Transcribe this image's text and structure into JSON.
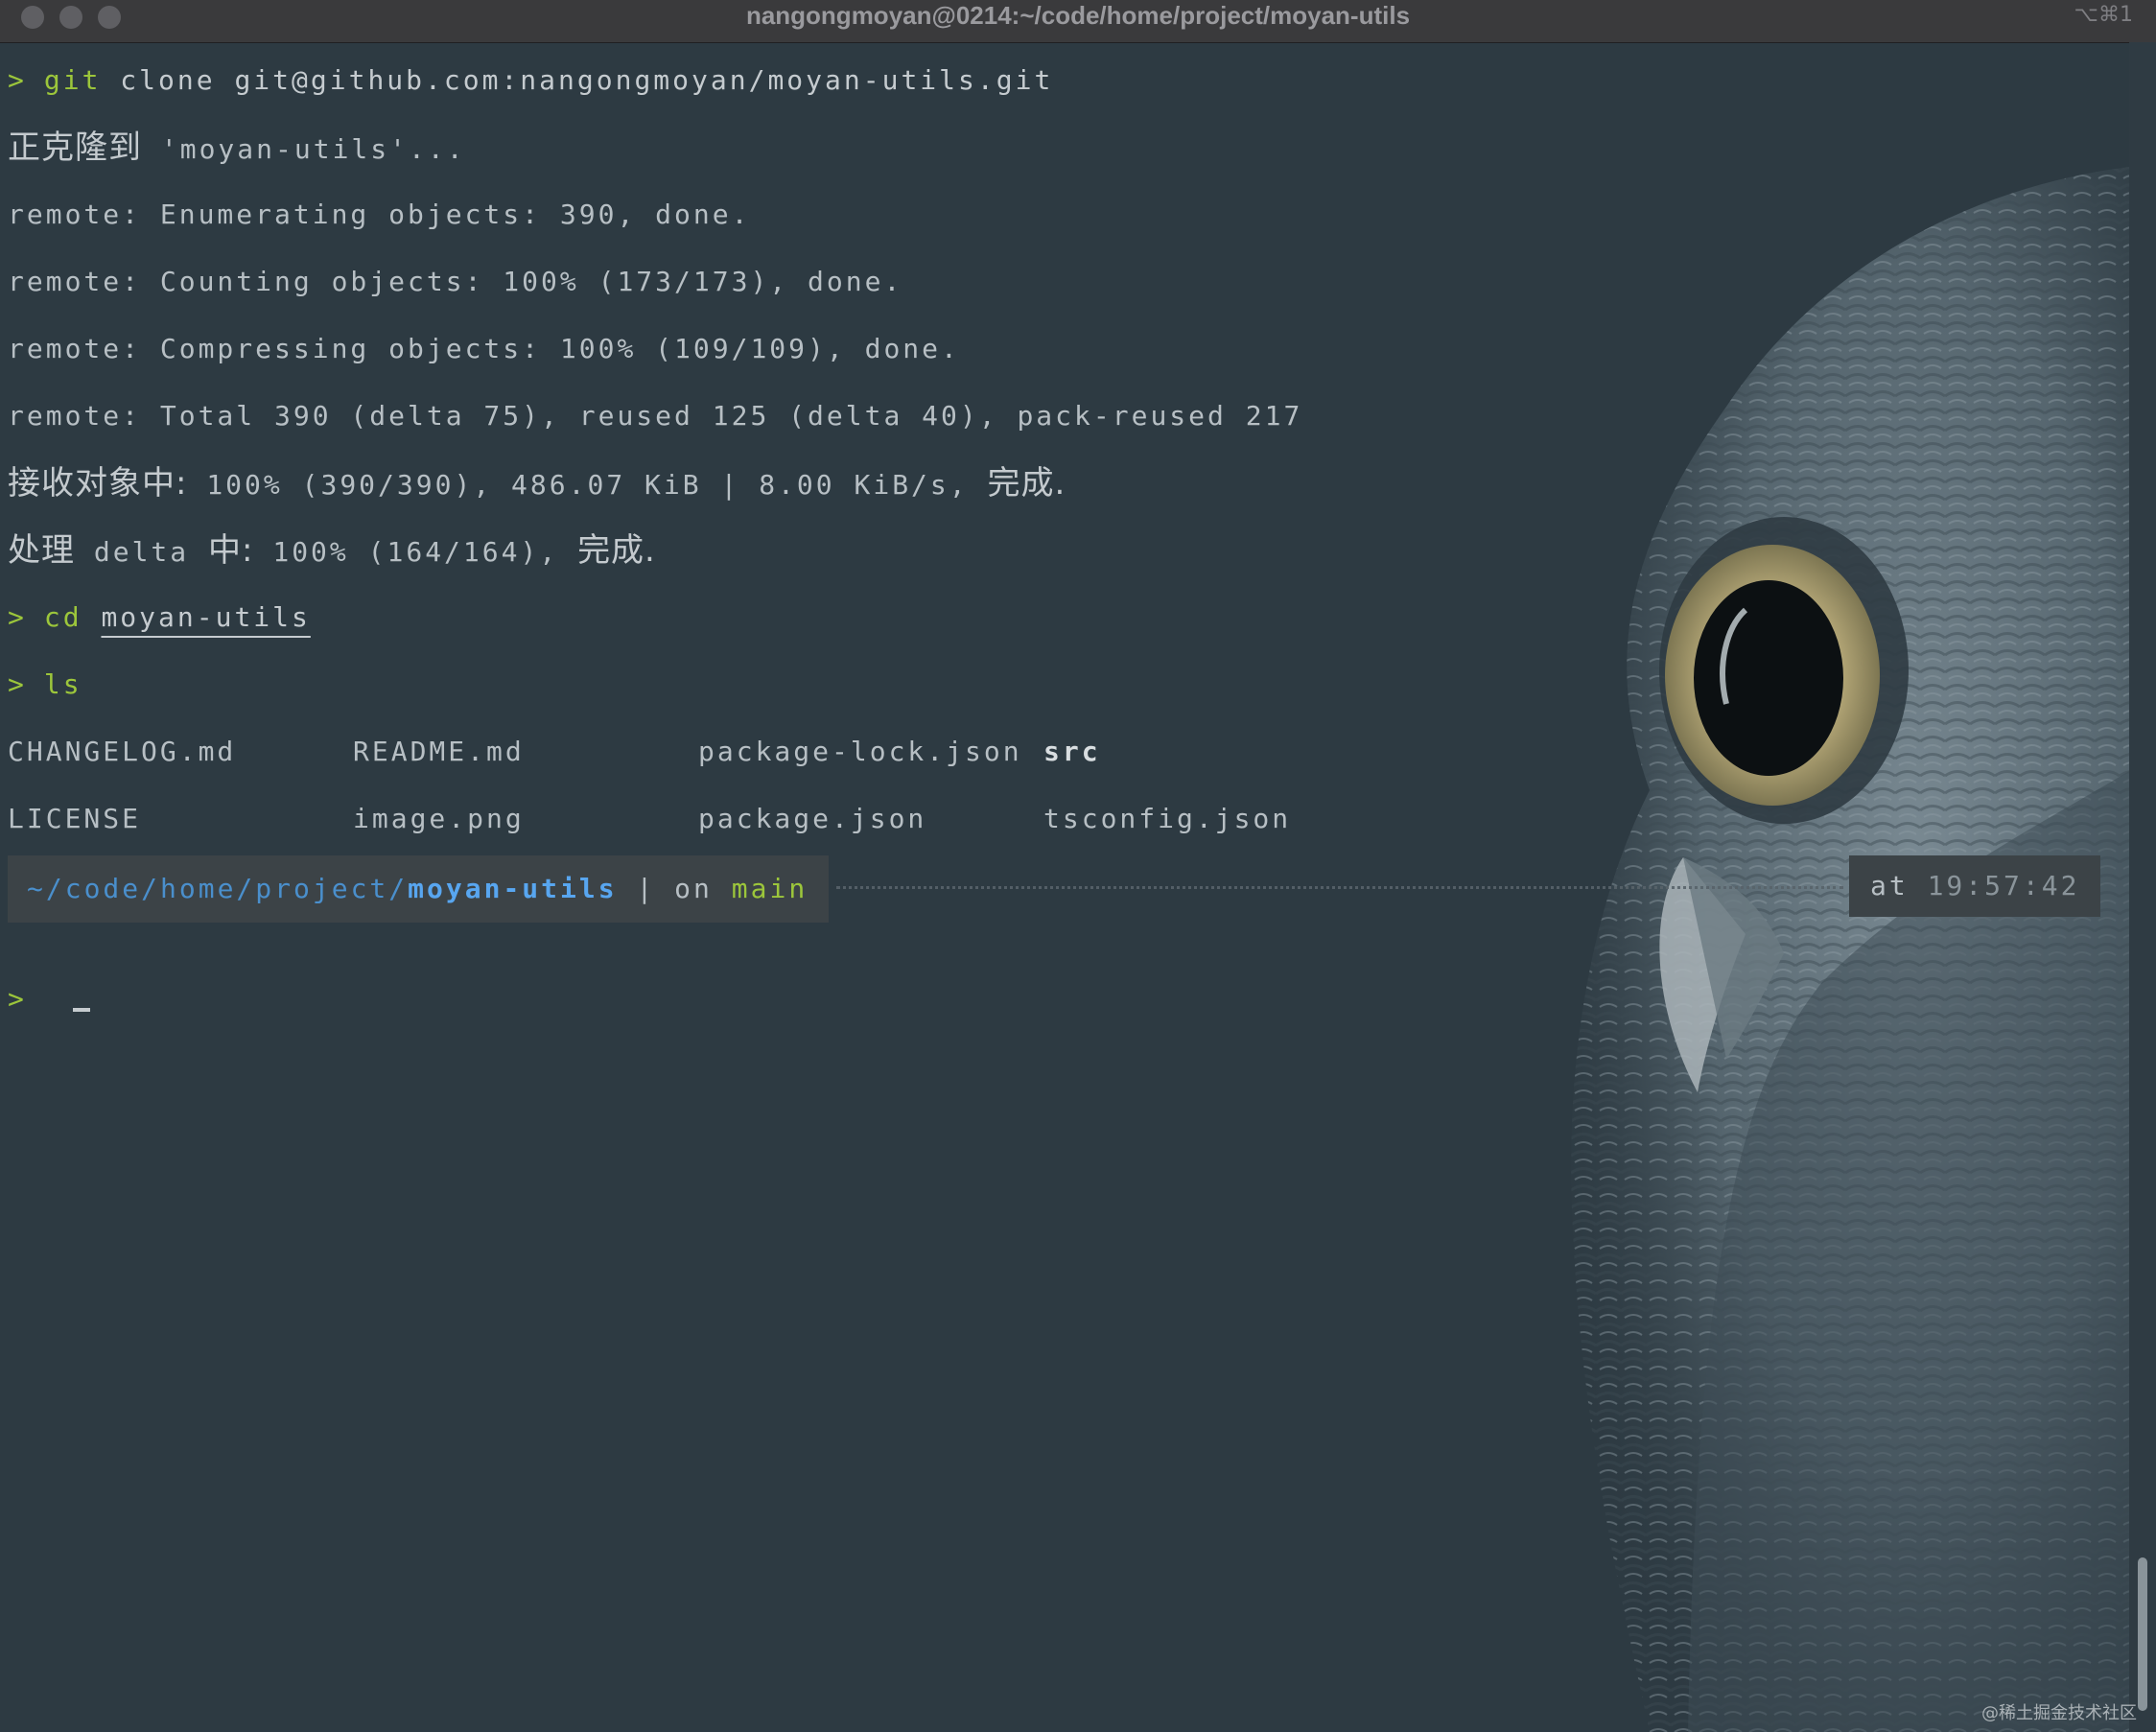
{
  "window": {
    "title": "nangongmoyan@0214:~/code/home/project/moyan-utils",
    "shortcut": "⌥⌘1"
  },
  "terminal": {
    "prompt_symbol": ">",
    "git_cmd": "git",
    "git_args": "clone git@github.com:nangongmoyan/moyan-utils.git",
    "clone_cjk": "正克隆到",
    "clone_target": " 'moyan-utils'...",
    "remote_1": "remote: Enumerating objects: 390, done.",
    "remote_2": "remote: Counting objects: 100% (173/173), done.",
    "remote_3": "remote: Compressing objects: 100% (109/109), done.",
    "remote_4": "remote: Total 390 (delta 75), reused 125 (delta 40), pack-reused 217",
    "recv_cjk": "接收对象中:",
    "recv_stats": " 100% (390/390), 486.07 KiB | 8.00 KiB/s,",
    "done_cjk": "完成.",
    "delta_cjk_1": "处理",
    "delta_word": " delta ",
    "delta_cjk_2": "中:",
    "delta_stats": " 100% (164/164),",
    "cd_cmd": "cd",
    "cd_arg": "moyan-utils",
    "ls_cmd": "ls",
    "ls_files": [
      [
        "CHANGELOG.md",
        "README.md",
        "package-lock.json",
        "src"
      ],
      [
        "LICENSE",
        "image.png",
        "package.json",
        "tsconfig.json"
      ]
    ],
    "powerline": {
      "path_prefix": "~/code/home/project/",
      "path_dir": "moyan-utils",
      "separator": " | ",
      "on_label": "on ",
      "branch": "main",
      "at_label": "at ",
      "time": "19:57:42"
    }
  },
  "watermark": "@稀土掘金技术社区",
  "colors": {
    "background": "#2d3a42",
    "prompt_green": "#9cc63b",
    "path_blue": "#58a6f0",
    "text": "#b7bfc4"
  },
  "background_image": "owl-photo"
}
